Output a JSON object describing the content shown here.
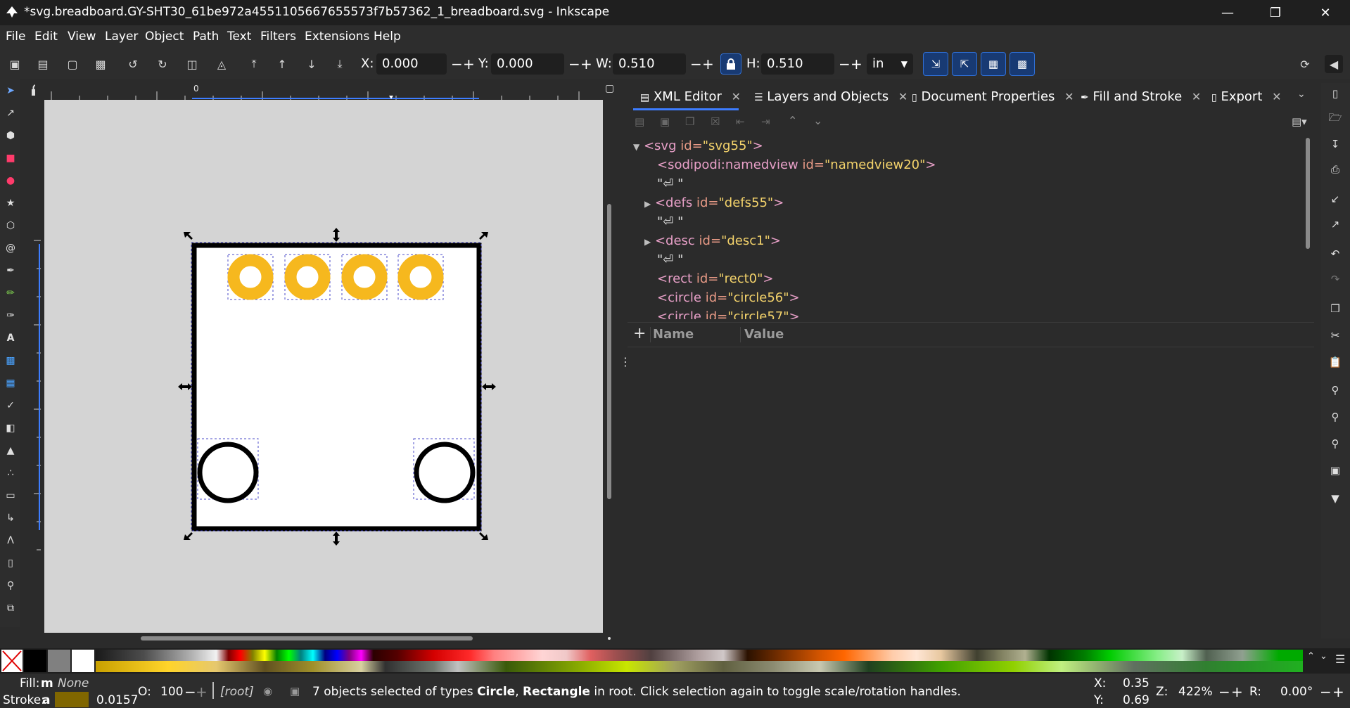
{
  "window": {
    "title": "*svg.breadboard.GY-SHT30_61be972a4551105667655573f7b57362_1_breadboard.svg - Inkscape"
  },
  "menu": [
    "File",
    "Edit",
    "View",
    "Layer",
    "Object",
    "Path",
    "Text",
    "Filters",
    "Extensions",
    "Help"
  ],
  "toolbar": {
    "x_label": "X:",
    "x_value": "0.000",
    "y_label": "Y:",
    "y_value": "0.000",
    "w_label": "W:",
    "w_value": "0.510",
    "h_label": "H:",
    "h_value": "0.510",
    "unit": "in"
  },
  "ruler": {
    "origin_label": "0"
  },
  "dock": {
    "tabs": [
      {
        "label": "XML Editor",
        "icon": "xml-editor-icon"
      },
      {
        "label": "Layers and Objects",
        "icon": "layers-icon"
      },
      {
        "label": "Document Properties",
        "icon": "document-icon"
      },
      {
        "label": "Fill and Stroke",
        "icon": "fill-stroke-icon"
      },
      {
        "label": "Export",
        "icon": "export-icon"
      }
    ],
    "xml_nodes": [
      {
        "tag": "<svg",
        "attr": " id=",
        "val": "\"svg55\"",
        "end": ">"
      },
      {
        "tag": "<sodipodi:namedview",
        "attr": " id=",
        "val": "\"namedview20\"",
        "end": ">"
      },
      {
        "text": "\"⏎   \""
      },
      {
        "tag": "<defs",
        "attr": " id=",
        "val": "\"defs55\"",
        "end": ">"
      },
      {
        "text": "\"⏎   \""
      },
      {
        "tag": "<desc",
        "attr": " id=",
        "val": "\"desc1\"",
        "end": ">"
      },
      {
        "text": "\"⏎   \""
      },
      {
        "tag": "<rect",
        "attr": " id=",
        "val": "\"rect0\"",
        "end": ">"
      },
      {
        "tag": "<circle",
        "attr": " id=",
        "val": "\"circle56\"",
        "end": ">"
      },
      {
        "tag": "<circle",
        "attr": " id=",
        "val": "\"circle57\"",
        "end": ">"
      }
    ],
    "attr_header": {
      "add": "+",
      "name": "Name",
      "value": "Value"
    }
  },
  "status": {
    "fill_label": "Fill:",
    "fill_value": "m",
    "fill_none": "None",
    "stroke_label": "Stroke:",
    "stroke_value": "a",
    "stroke_width": "0.0157",
    "opacity_label": "O:",
    "opacity_value": "100",
    "layer": "[root]",
    "message_pre": "7 objects selected of types ",
    "message_b1": "Circle",
    "message_mid": ", ",
    "message_b2": "Rectangle",
    "message_post": " in root. Click selection again to toggle scale/rotation handles.",
    "cursor_x_label": "X:",
    "cursor_x": "0.35",
    "cursor_y_label": "Y:",
    "cursor_y": "0.69",
    "zoom_label": "Z:",
    "zoom": "422%",
    "rotate_label": "R:",
    "rotate": "0.00°"
  },
  "colors": {
    "pin_fill": "#F6B81E",
    "selection_dash": "#4b4bc8",
    "accent_blue": "#2f6fd6"
  }
}
